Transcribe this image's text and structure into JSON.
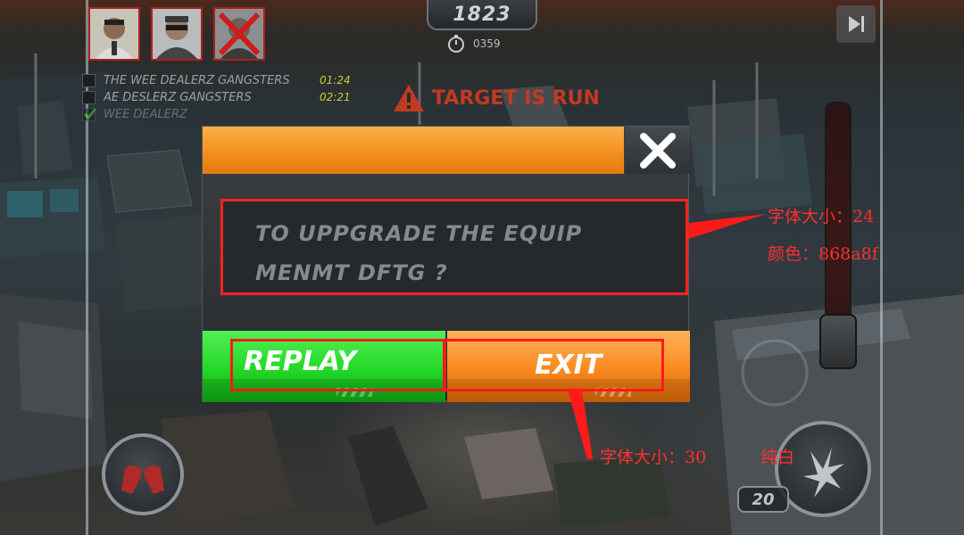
{
  "hud": {
    "score": "1823",
    "timer": "0359",
    "alert": "TARGET IS RUN",
    "ammo": "20"
  },
  "targets": [
    {
      "name": "THE WEE DEALERZ GANGSTERS",
      "time": "01:24",
      "checked": false
    },
    {
      "name": "AE DESLERZ GANGSTERS",
      "time": "02:21",
      "checked": false
    },
    {
      "name": "WEE DEALERZ",
      "time": "",
      "checked": true
    }
  ],
  "dialog": {
    "message_line1": "TO UPPGRADE THE EQUIP",
    "message_line2": "MENMT DFTG ?",
    "replay_label": "REPLAY",
    "exit_label": "EXIT",
    "colors": {
      "bar": "#f48f1e",
      "text": "#868a8f",
      "replay": "#23d826",
      "exit": "#f8891e"
    }
  },
  "annotations": {
    "message_note_size": "字体大小：24",
    "message_note_color": "颜色：868a8f",
    "button_note_size": "字体大小：30",
    "button_note_color": "纯白",
    "highlight_color": "#ff1a1a"
  },
  "icons": {
    "close": "close-icon",
    "skip": "skip-icon",
    "warning": "warning-icon",
    "stopwatch": "stopwatch-icon",
    "lungs": "lungs-icon",
    "fire": "fire-icon"
  }
}
